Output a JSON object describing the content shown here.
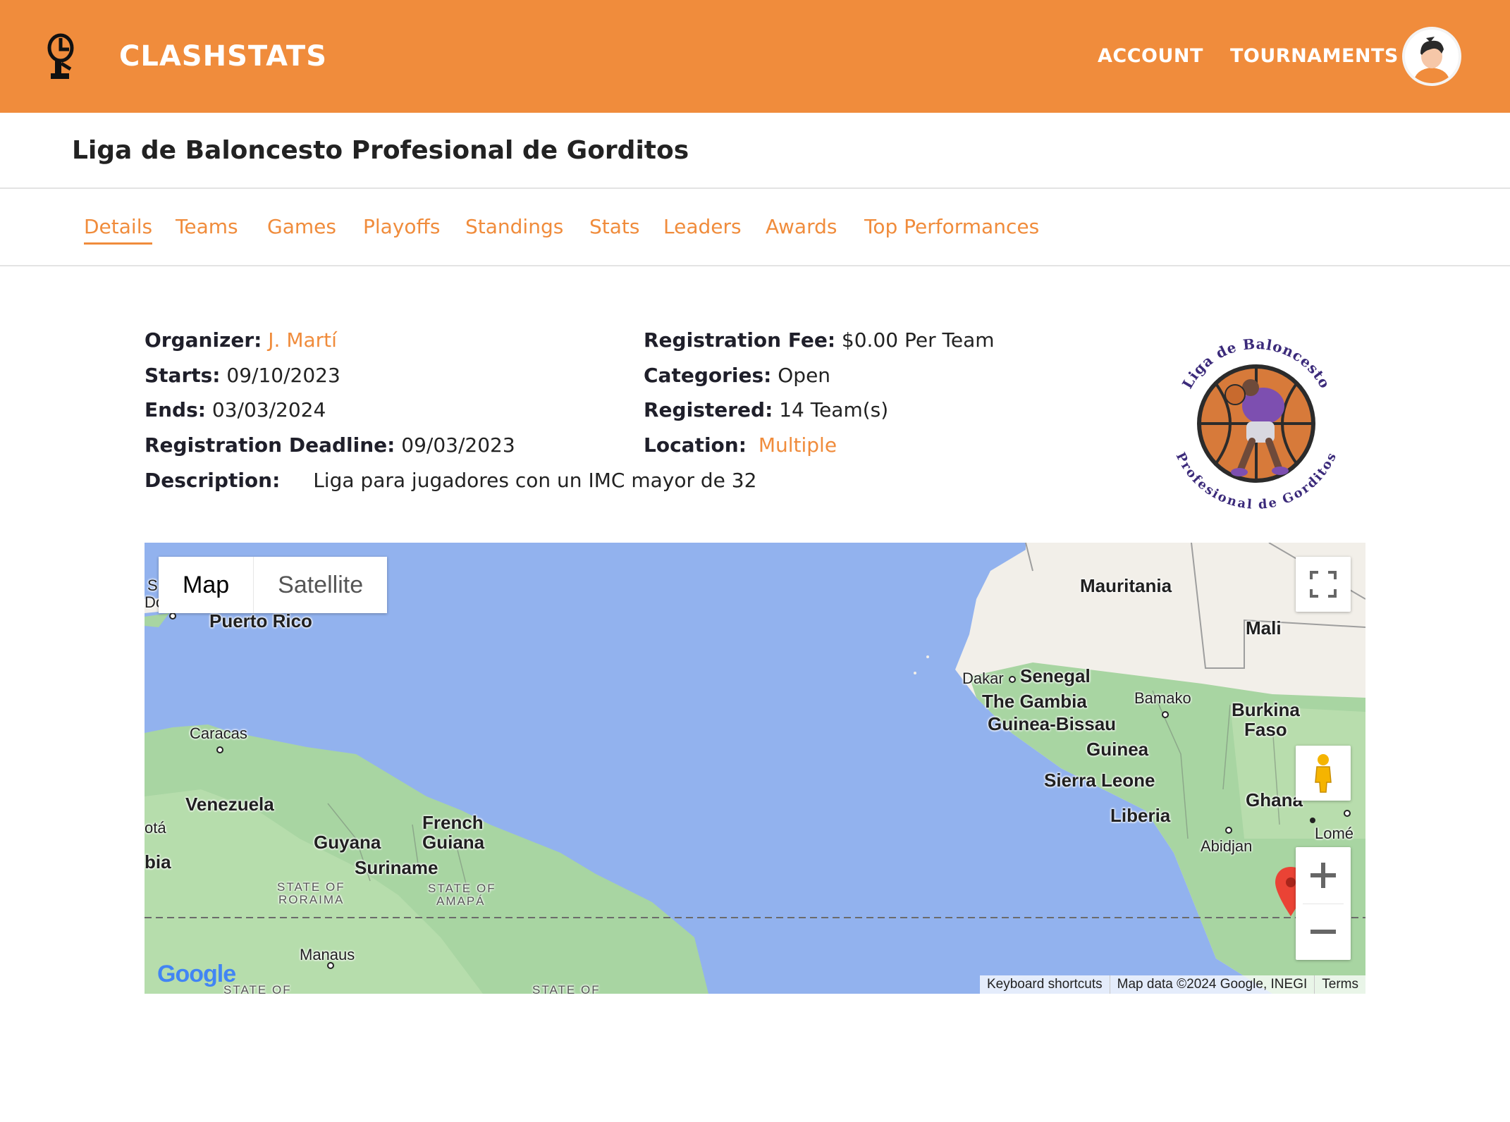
{
  "header": {
    "brand": "CLASHSTATS",
    "nav": {
      "account": "ACCOUNT",
      "tournaments": "TOURNAMENTS"
    },
    "accent_color": "#f08c3c"
  },
  "page": {
    "title": "Liga de Baloncesto Profesional de Gorditos"
  },
  "tabs": [
    {
      "label": "Details",
      "active": true
    },
    {
      "label": "Teams"
    },
    {
      "label": "Games"
    },
    {
      "label": "Playoffs"
    },
    {
      "label": "Standings"
    },
    {
      "label": "Stats"
    },
    {
      "label": "Leaders"
    },
    {
      "label": "Awards"
    },
    {
      "label": "Top Performances"
    }
  ],
  "details": {
    "organizer": {
      "label": "Organizer:",
      "value": "J. Martí"
    },
    "starts": {
      "label": "Starts:",
      "value": "09/10/2023"
    },
    "ends": {
      "label": "Ends:",
      "value": "03/03/2024"
    },
    "deadline": {
      "label": "Registration Deadline:",
      "value": "09/03/2023"
    },
    "description": {
      "label": "Description:",
      "value": "Liga para jugadores con un IMC mayor de 32"
    },
    "fee": {
      "label": "Registration Fee:",
      "value": "$0.00 Per Team"
    },
    "categories": {
      "label": "Categories:",
      "value": "Open"
    },
    "registered": {
      "label": "Registered:",
      "value": "14 Team(s)"
    },
    "location": {
      "label": "Location:",
      "value": "Multiple"
    }
  },
  "logo": {
    "text_top": "Liga de Baloncesto",
    "text_bottom": "Profesional de Gorditos"
  },
  "map": {
    "type_toggle": {
      "map": "Map",
      "satellite": "Satellite",
      "selected": "Map"
    },
    "labels": {
      "puerto_rico": "Puerto Rico",
      "caracas": "Caracas",
      "venezuela": "Venezuela",
      "guyana": "Guyana",
      "french_guiana_1": "French",
      "french_guiana_2": "Guiana",
      "suriname": "Suriname",
      "roraima_1": "STATE OF",
      "roraima_2": "RORAIMA",
      "amapa_1": "STATE OF",
      "amapa_2": "AMAPÁ",
      "manaus": "Manaus",
      "state_of_bottom_1": "STATE OF",
      "state_of_bottom_2": "STATE OF",
      "mauritania": "Mauritania",
      "mali": "Mali",
      "dakar": "Dakar",
      "senegal": "Senegal",
      "the_gambia": "The Gambia",
      "guinea_bissau": "Guinea-Bissau",
      "bamako": "Bamako",
      "burkina_1": "Burkina",
      "burkina_2": "Faso",
      "guinea": "Guinea",
      "sierra_leone": "Sierra Leone",
      "liberia": "Liberia",
      "ghana": "Ghana",
      "abidjan": "Abidjan",
      "lome": "Lomé",
      "edge_bogota": "otá",
      "edge_colombia": "bia",
      "edge_s": "S",
      "edge_do": "Do"
    },
    "attribution": {
      "keyboard": "Keyboard shortcuts",
      "data": "Map data ©2024 Google, INEGI",
      "terms": "Terms"
    },
    "google": "Google",
    "colors": {
      "water": "#92b2ee",
      "land": "#f2efe9",
      "vegetation": "#a8d5a2",
      "marker": "#ea4335"
    }
  }
}
